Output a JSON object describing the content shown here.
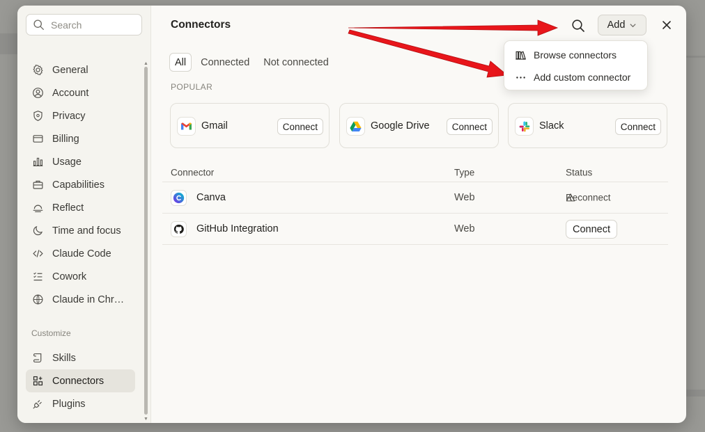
{
  "sidebar": {
    "search_placeholder": "Search",
    "items": [
      {
        "label": "General"
      },
      {
        "label": "Account"
      },
      {
        "label": "Privacy"
      },
      {
        "label": "Billing"
      },
      {
        "label": "Usage"
      },
      {
        "label": "Capabilities"
      },
      {
        "label": "Reflect"
      },
      {
        "label": "Time and focus"
      },
      {
        "label": "Claude Code"
      },
      {
        "label": "Cowork"
      },
      {
        "label": "Claude in Chr…"
      }
    ],
    "section_label": "Customize",
    "customize_items": [
      {
        "label": "Skills"
      },
      {
        "label": "Connectors",
        "active": true
      },
      {
        "label": "Plugins"
      }
    ]
  },
  "header": {
    "title": "Connectors",
    "add_label": "Add"
  },
  "dropdown": {
    "items": [
      {
        "label": "Browse connectors",
        "icon": "library-icon"
      },
      {
        "label": "Add custom connector",
        "icon": "ellipsis-icon"
      }
    ]
  },
  "tabs": [
    {
      "label": "All",
      "active": true
    },
    {
      "label": "Connected"
    },
    {
      "label": "Not connected"
    }
  ],
  "popular": {
    "label": "POPULAR",
    "cards": [
      {
        "name": "Gmail",
        "button": "Connect",
        "icon": "gmail-icon"
      },
      {
        "name": "Google Drive",
        "button": "Connect",
        "icon": "google-drive-icon"
      },
      {
        "name": "Slack",
        "button": "Connect",
        "icon": "slack-icon"
      }
    ]
  },
  "table": {
    "headers": [
      "Connector",
      "Type",
      "Status"
    ],
    "rows": [
      {
        "name": "Canva",
        "type": "Web",
        "status": "Reconnect",
        "icon": "canva-icon"
      },
      {
        "name": "GitHub Integration",
        "type": "Web",
        "status": "Connect",
        "icon": "github-icon"
      }
    ]
  },
  "colors": {
    "accent_arrow": "#e8161b",
    "active_nav_bg": "#e6e4dd"
  }
}
